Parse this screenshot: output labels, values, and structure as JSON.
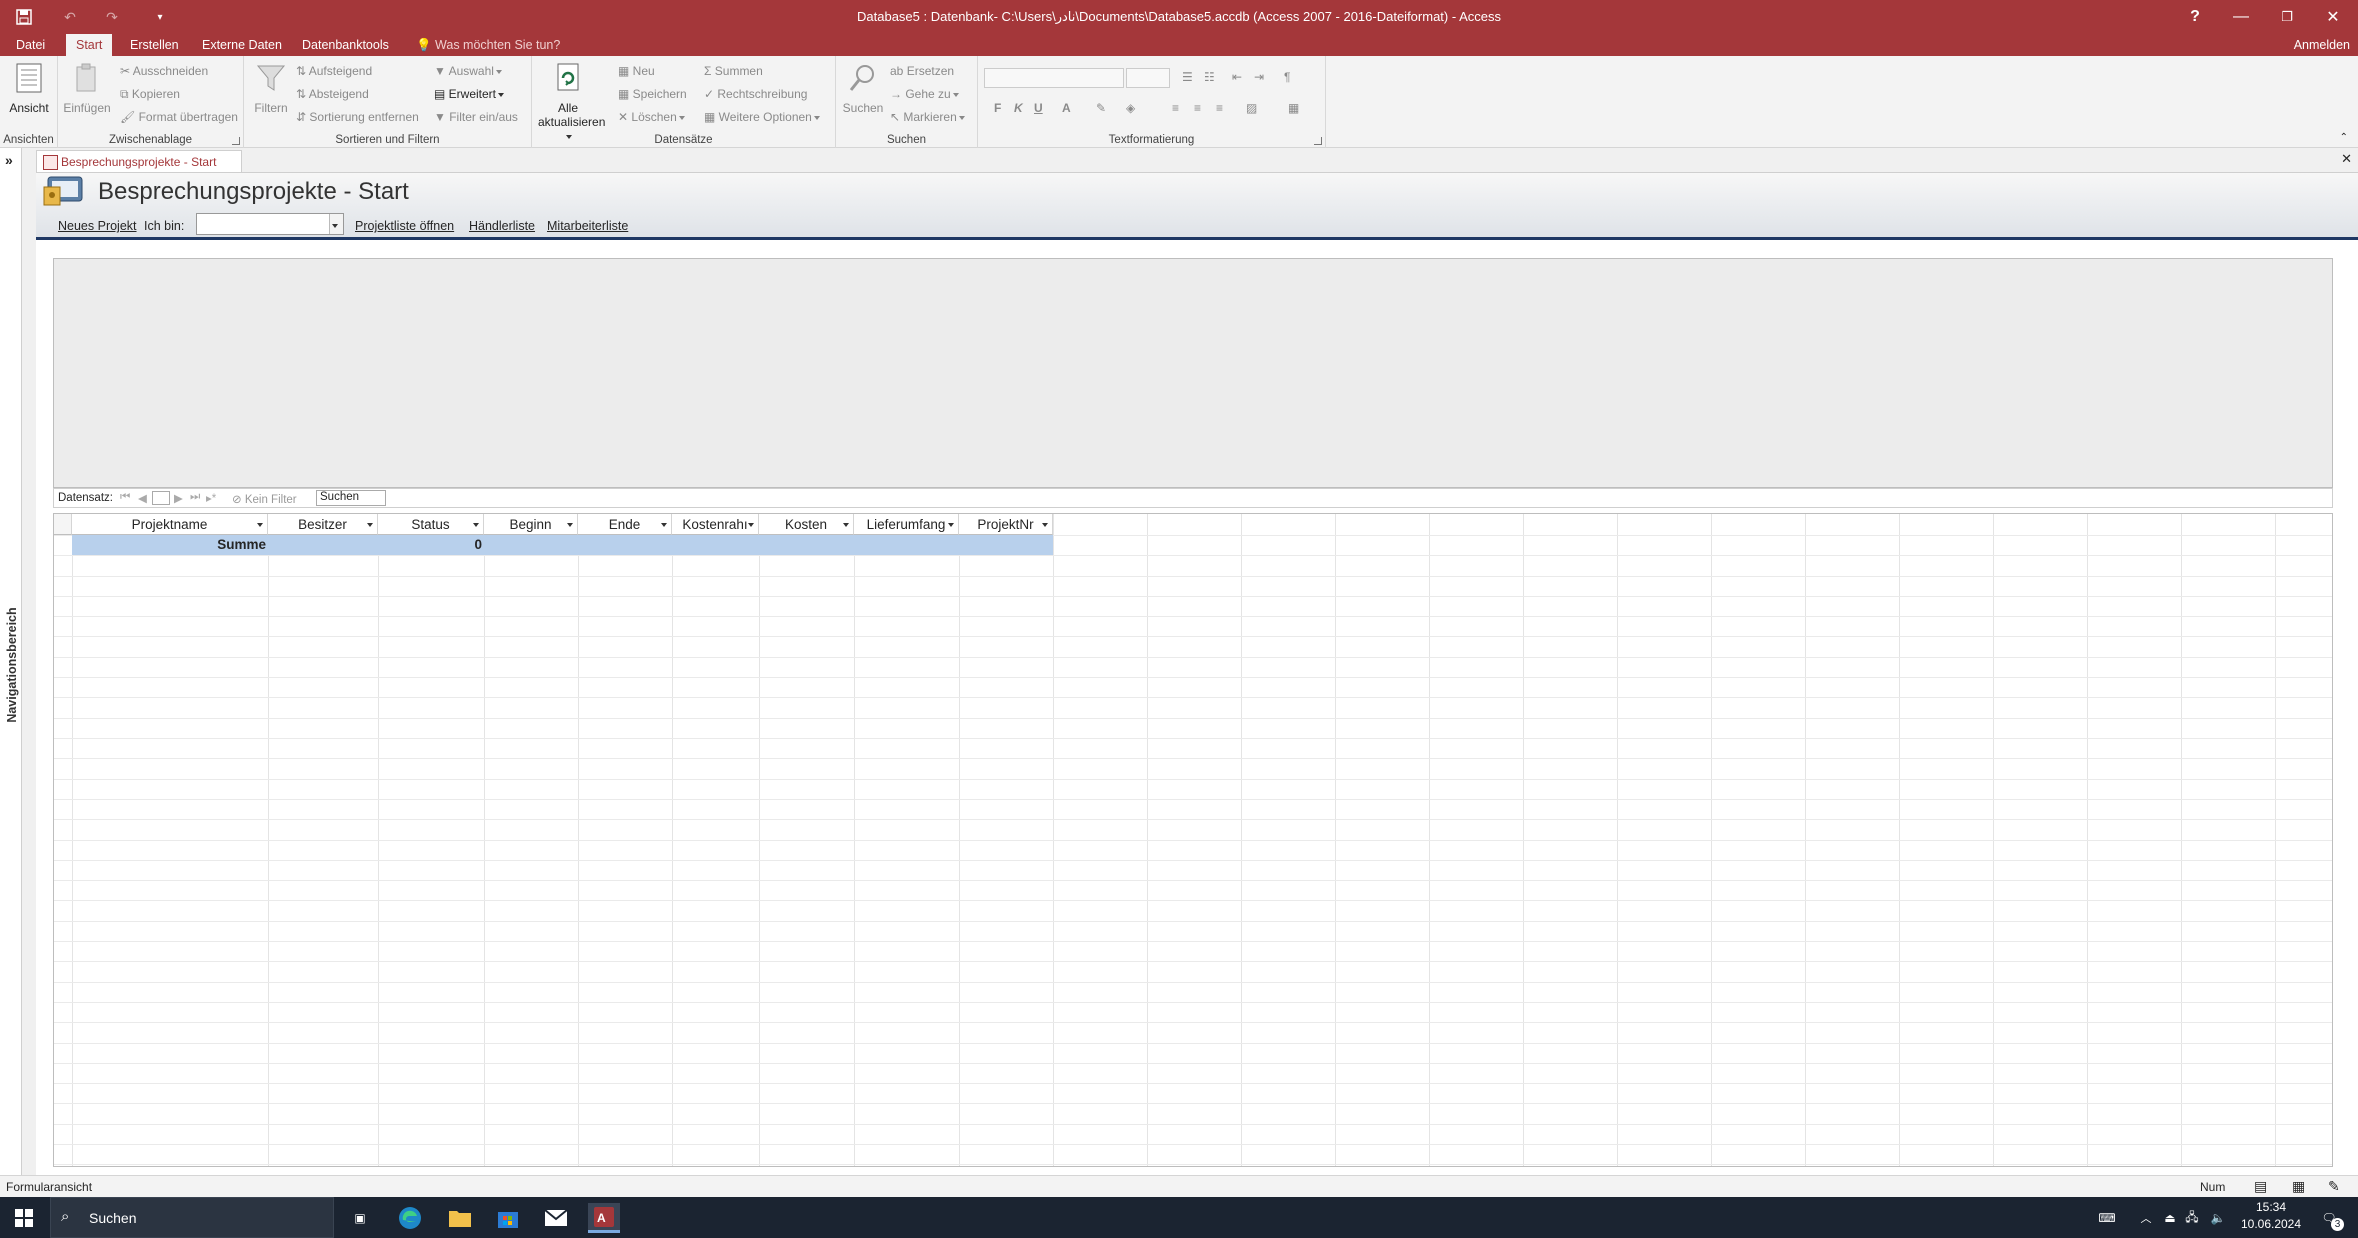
{
  "window": {
    "title": "Database5 : Datenbank- C:\\Users\\نادر\\Documents\\Database5.accdb (Access 2007 - 2016-Dateiformat) - Access",
    "help": "?",
    "minimize": "—",
    "restore": "❐",
    "close": "✕"
  },
  "tabs": [
    "Datei",
    "Start",
    "Erstellen",
    "Externe Daten",
    "Datenbanktools"
  ],
  "active_tab": "Start",
  "tell_me": "Was möchten Sie tun?",
  "sign_in": "Anmelden",
  "ribbon": {
    "ansichten": {
      "btn": "Ansicht",
      "group": "Ansichten"
    },
    "zwischenablage": {
      "paste": "Einfügen",
      "cut": "Ausschneiden",
      "copy": "Kopieren",
      "format": "Format übertragen",
      "group": "Zwischenablage"
    },
    "sortieren": {
      "filter": "Filtern",
      "asc": "Aufsteigend",
      "desc": "Absteigend",
      "remove": "Sortierung entfernen",
      "selection": "Auswahl",
      "advanced": "Erweitert",
      "toggle": "Filter ein/aus",
      "group": "Sortieren und Filtern"
    },
    "datensaetze": {
      "refresh1": "Alle",
      "refresh2": "aktualisieren",
      "new": "Neu",
      "save": "Speichern",
      "delete": "Löschen",
      "totals": "Summen",
      "spelling": "Rechtschreibung",
      "more": "Weitere Optionen",
      "group": "Datensätze"
    },
    "suchen": {
      "find": "Suchen",
      "replace": "Ersetzen",
      "goto": "Gehe zu",
      "select": "Markieren",
      "group": "Suchen"
    },
    "text": {
      "bold": "F",
      "italic": "K",
      "underline": "U",
      "fontcolor": "A",
      "group": "Textformatierung"
    }
  },
  "nav_pane": {
    "label": "Navigationsbereich",
    "toggle": "»"
  },
  "document_tab": "Besprechungsprojekte - Start",
  "doc_close": "✕",
  "form": {
    "title": "Besprechungsprojekte - Start",
    "new_project": "Neues Projekt",
    "iam_label": "Ich bin:",
    "iam_value": "",
    "open_list": "Projektliste öffnen",
    "dealer_list": "Händlerliste",
    "staff_list": "Mitarbeiterliste"
  },
  "record_nav": {
    "label": "Datensatz:",
    "filter": "Kein Filter",
    "search": "Suchen"
  },
  "datasheet": {
    "columns": [
      "Projektname",
      "Besitzer",
      "Status",
      "Beginn",
      "Ende",
      "Kostenrahı",
      "Kosten",
      "Lieferumfang",
      "ProjektNr"
    ],
    "sum_label": "Summe",
    "sum_status": "0"
  },
  "status": {
    "left": "Formularansicht",
    "num": "Num"
  },
  "taskbar": {
    "search": "Suchen",
    "time": "15:34",
    "date": "10.06.2024",
    "notif": "3"
  }
}
